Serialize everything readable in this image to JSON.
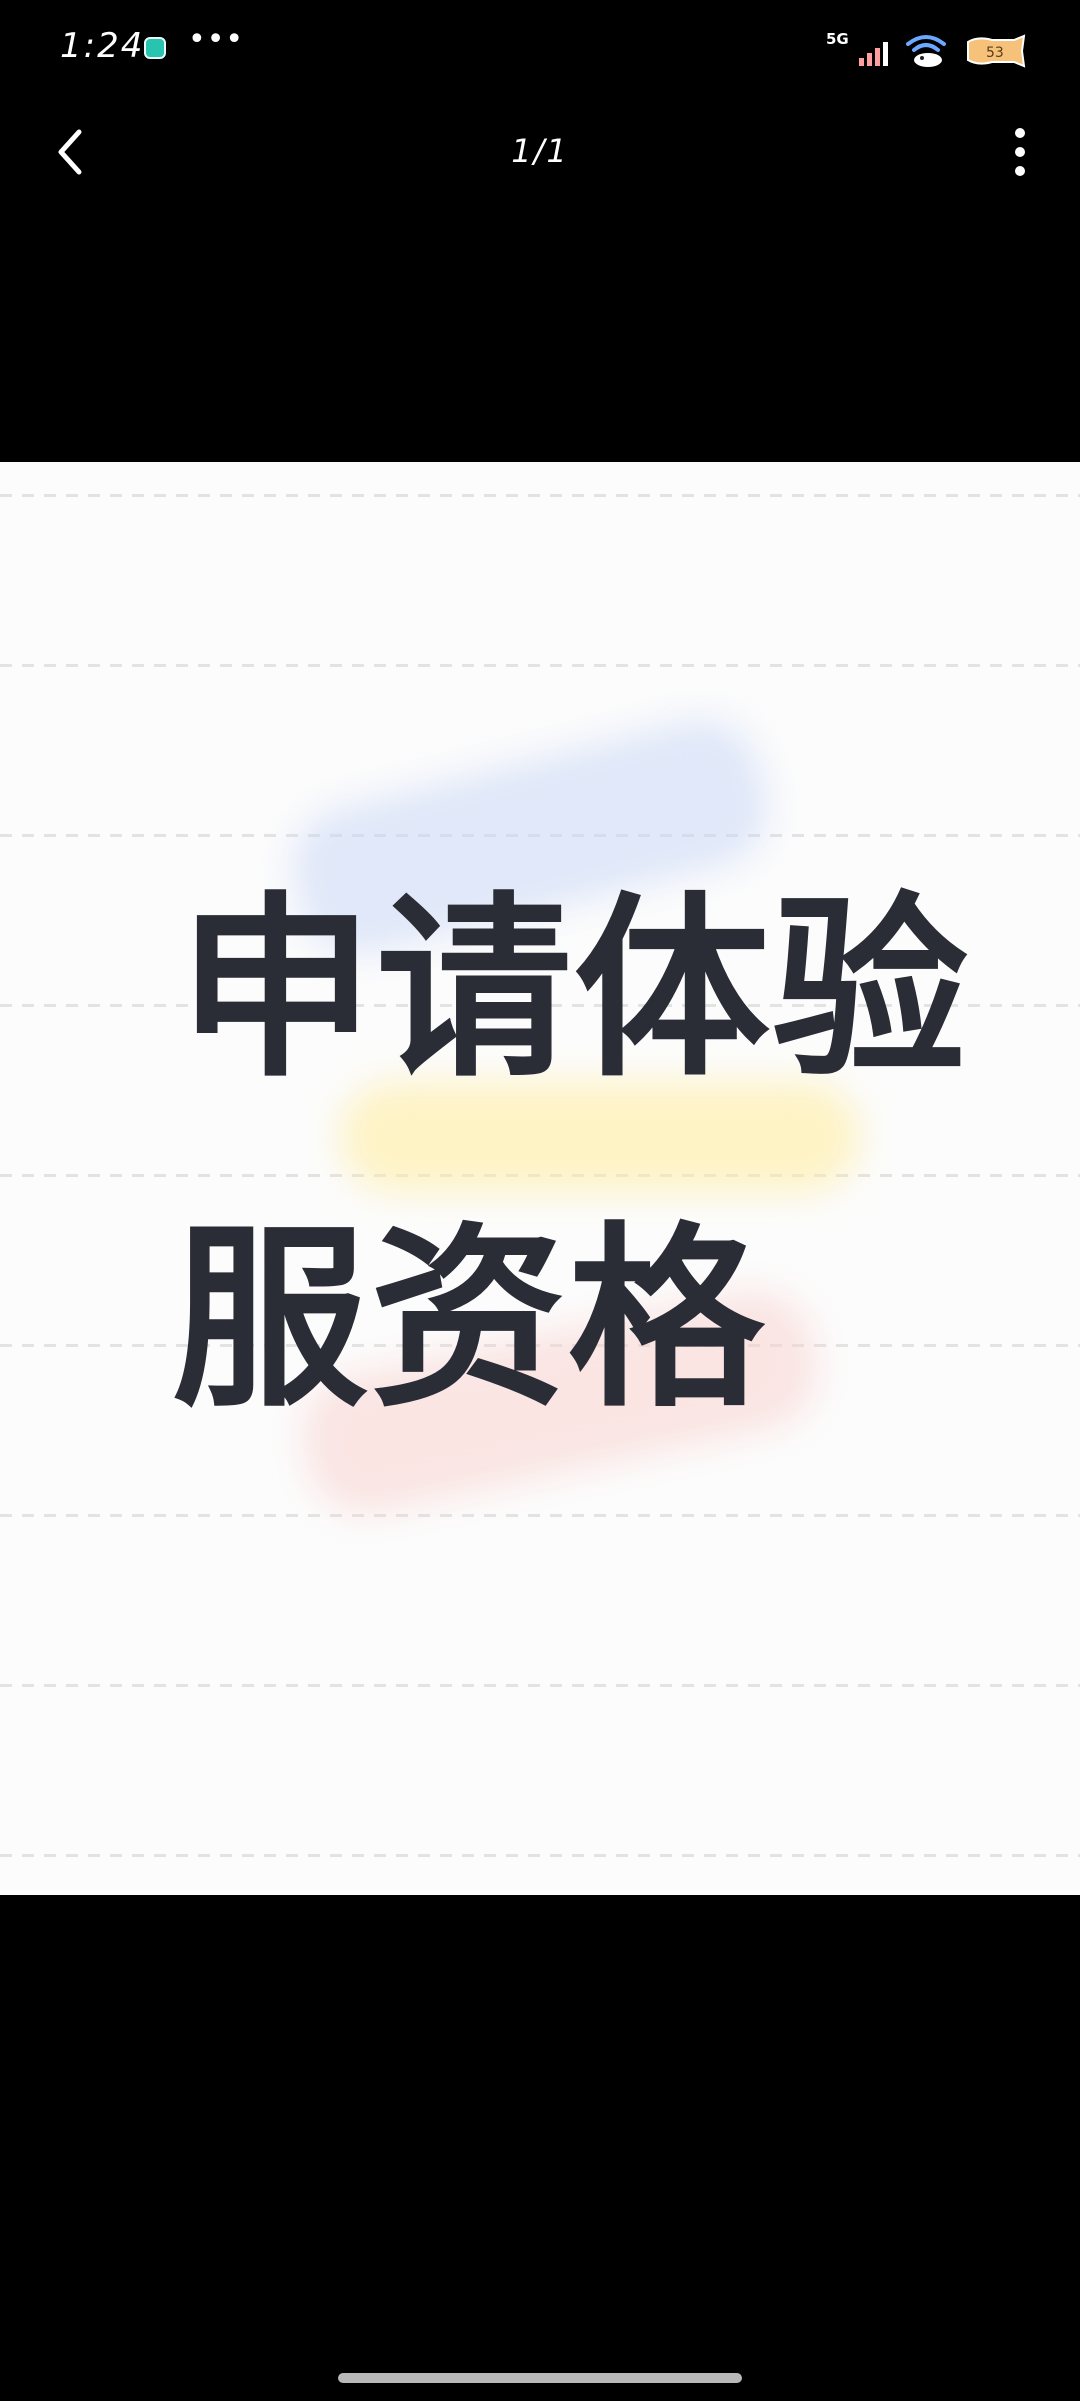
{
  "status_bar": {
    "time": "1:24",
    "app_icon": "teal-app-icon",
    "more_indicator": "•••",
    "signal_label": "5G",
    "signal_icon": "signal-bars-icon",
    "wifi_icon": "wifi-icon",
    "battery_icon": "battery-icon"
  },
  "app_bar": {
    "back_icon": "chevron-left-icon",
    "page_counter": "1/1",
    "more_icon": "vertical-dots-icon"
  },
  "image": {
    "line1": "申请体验",
    "line2": "服资格"
  },
  "colors": {
    "background": "#000000",
    "image_background": "#fcfcfc",
    "text": "#2a2c36",
    "signal_accent": "#ff9fa0"
  }
}
